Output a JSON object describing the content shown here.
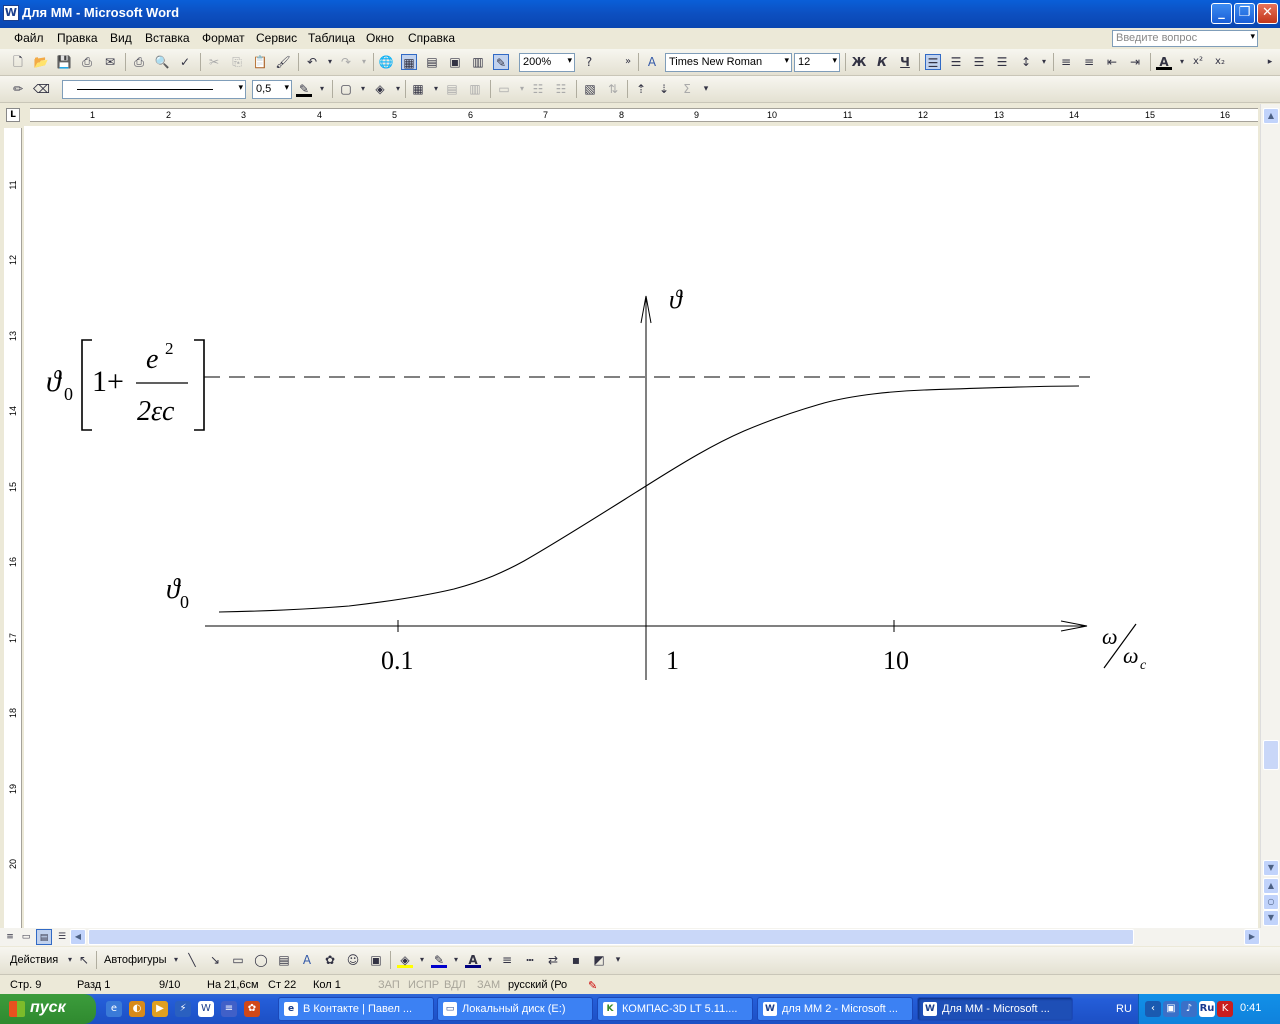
{
  "window": {
    "title": "Для ММ - Microsoft Word",
    "minimize": "_",
    "restore": "❐",
    "close": "✕"
  },
  "menu": {
    "items": [
      "Файл",
      "Правка",
      "Вид",
      "Вставка",
      "Формат",
      "Сервис",
      "Таблица",
      "Окно",
      "Справка"
    ],
    "help_placeholder": "Введите вопрос"
  },
  "toolbar": {
    "zoom": "200%",
    "font": "Times New Roman",
    "font_size": "12",
    "bold": "Ж",
    "italic": "К",
    "underline": "Ч",
    "line_weight": "0,5"
  },
  "ruler": {
    "h_numbers": [
      "1",
      "2",
      "3",
      "4",
      "5",
      "6",
      "7",
      "8",
      "9",
      "10",
      "11",
      "12",
      "13",
      "14",
      "15",
      "16"
    ],
    "v_numbers": [
      "11",
      "12",
      "13",
      "14",
      "15",
      "16",
      "17",
      "18",
      "19",
      "20"
    ]
  },
  "figure": {
    "upper_formula": {
      "symbol": "ϑ",
      "subscript": "0",
      "one_plus": "1+",
      "numerator": "e",
      "exponent": "2",
      "denominator": "2εc"
    },
    "y_axis_label": "ϑ",
    "lower_label": {
      "symbol": "ϑ",
      "subscript": "0"
    },
    "x_axis_label": {
      "numerator": "ω",
      "denominator": "ω",
      "denominator_sub": "c"
    },
    "x_ticks": [
      "0.1",
      "1",
      "10"
    ]
  },
  "drawbar": {
    "actions": "Действия",
    "autoshapes": "Автофигуры"
  },
  "status": {
    "page": "Стр. 9",
    "section": "Разд 1",
    "pages": "9/10",
    "at": "На 21,6см",
    "line": "Ст 22",
    "col": "Кол 1",
    "rec": "ЗАП",
    "trk": "ИСПР",
    "ext": "ВДЛ",
    "ovr": "ЗАМ",
    "lang": "русский (Ро"
  },
  "taskbar": {
    "start": "пуск",
    "tasks": [
      "В Контакте | Павел ...",
      "Локальный диск (E:)",
      "КОМПАС-3D LT 5.11....",
      "для ММ 2 - Microsoft ...",
      "Для ММ - Microsoft ..."
    ],
    "lang": "RU",
    "clock": "0:41"
  }
}
